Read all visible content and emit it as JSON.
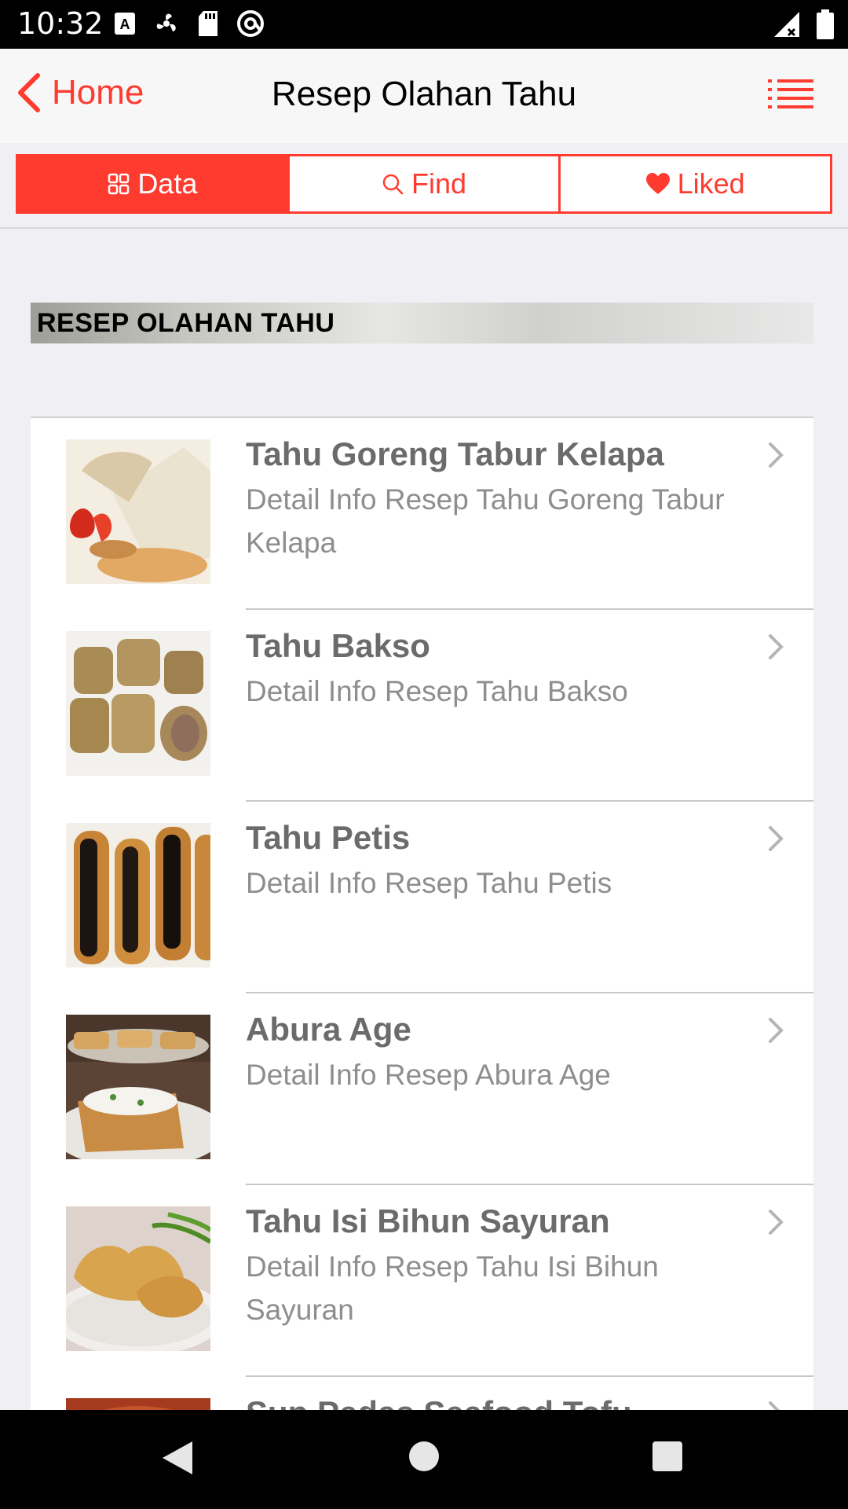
{
  "status_bar": {
    "time": "10:32",
    "left_icons": [
      "font-a-icon",
      "fan-icon",
      "sd-card-icon",
      "at-icon"
    ],
    "right_icons": [
      "signal-icon",
      "battery-icon"
    ]
  },
  "navbar": {
    "back_label": "Home",
    "title": "Resep Olahan Tahu",
    "menu_icon": "list-icon"
  },
  "tabs": [
    {
      "label": "Data",
      "icon": "grid-icon",
      "active": true
    },
    {
      "label": "Find",
      "icon": "search-icon",
      "active": false
    },
    {
      "label": "Liked",
      "icon": "heart-icon",
      "active": false
    }
  ],
  "section": {
    "title": "RESEP OLAHAN TAHU"
  },
  "recipes": [
    {
      "title": "Tahu Goreng Tabur Kelapa",
      "subtitle": "Detail Info Resep Tahu Goreng Tabur Kelapa"
    },
    {
      "title": "Tahu Bakso",
      "subtitle": "Detail Info Resep Tahu Bakso"
    },
    {
      "title": "Tahu Petis",
      "subtitle": "Detail Info Resep Tahu Petis"
    },
    {
      "title": "Abura Age",
      "subtitle": "Detail Info Resep Abura Age"
    },
    {
      "title": "Tahu Isi Bihun Sayuran",
      "subtitle": "Detail Info Resep Tahu Isi Bihun Sayuran"
    },
    {
      "title": "Sup Pedas Seafood Tofu",
      "subtitle": ""
    }
  ],
  "colors": {
    "accent": "#ff3b30",
    "background": "#efeff4",
    "title_text": "#6b6b6b",
    "subtitle_text": "#8e8e8e"
  }
}
